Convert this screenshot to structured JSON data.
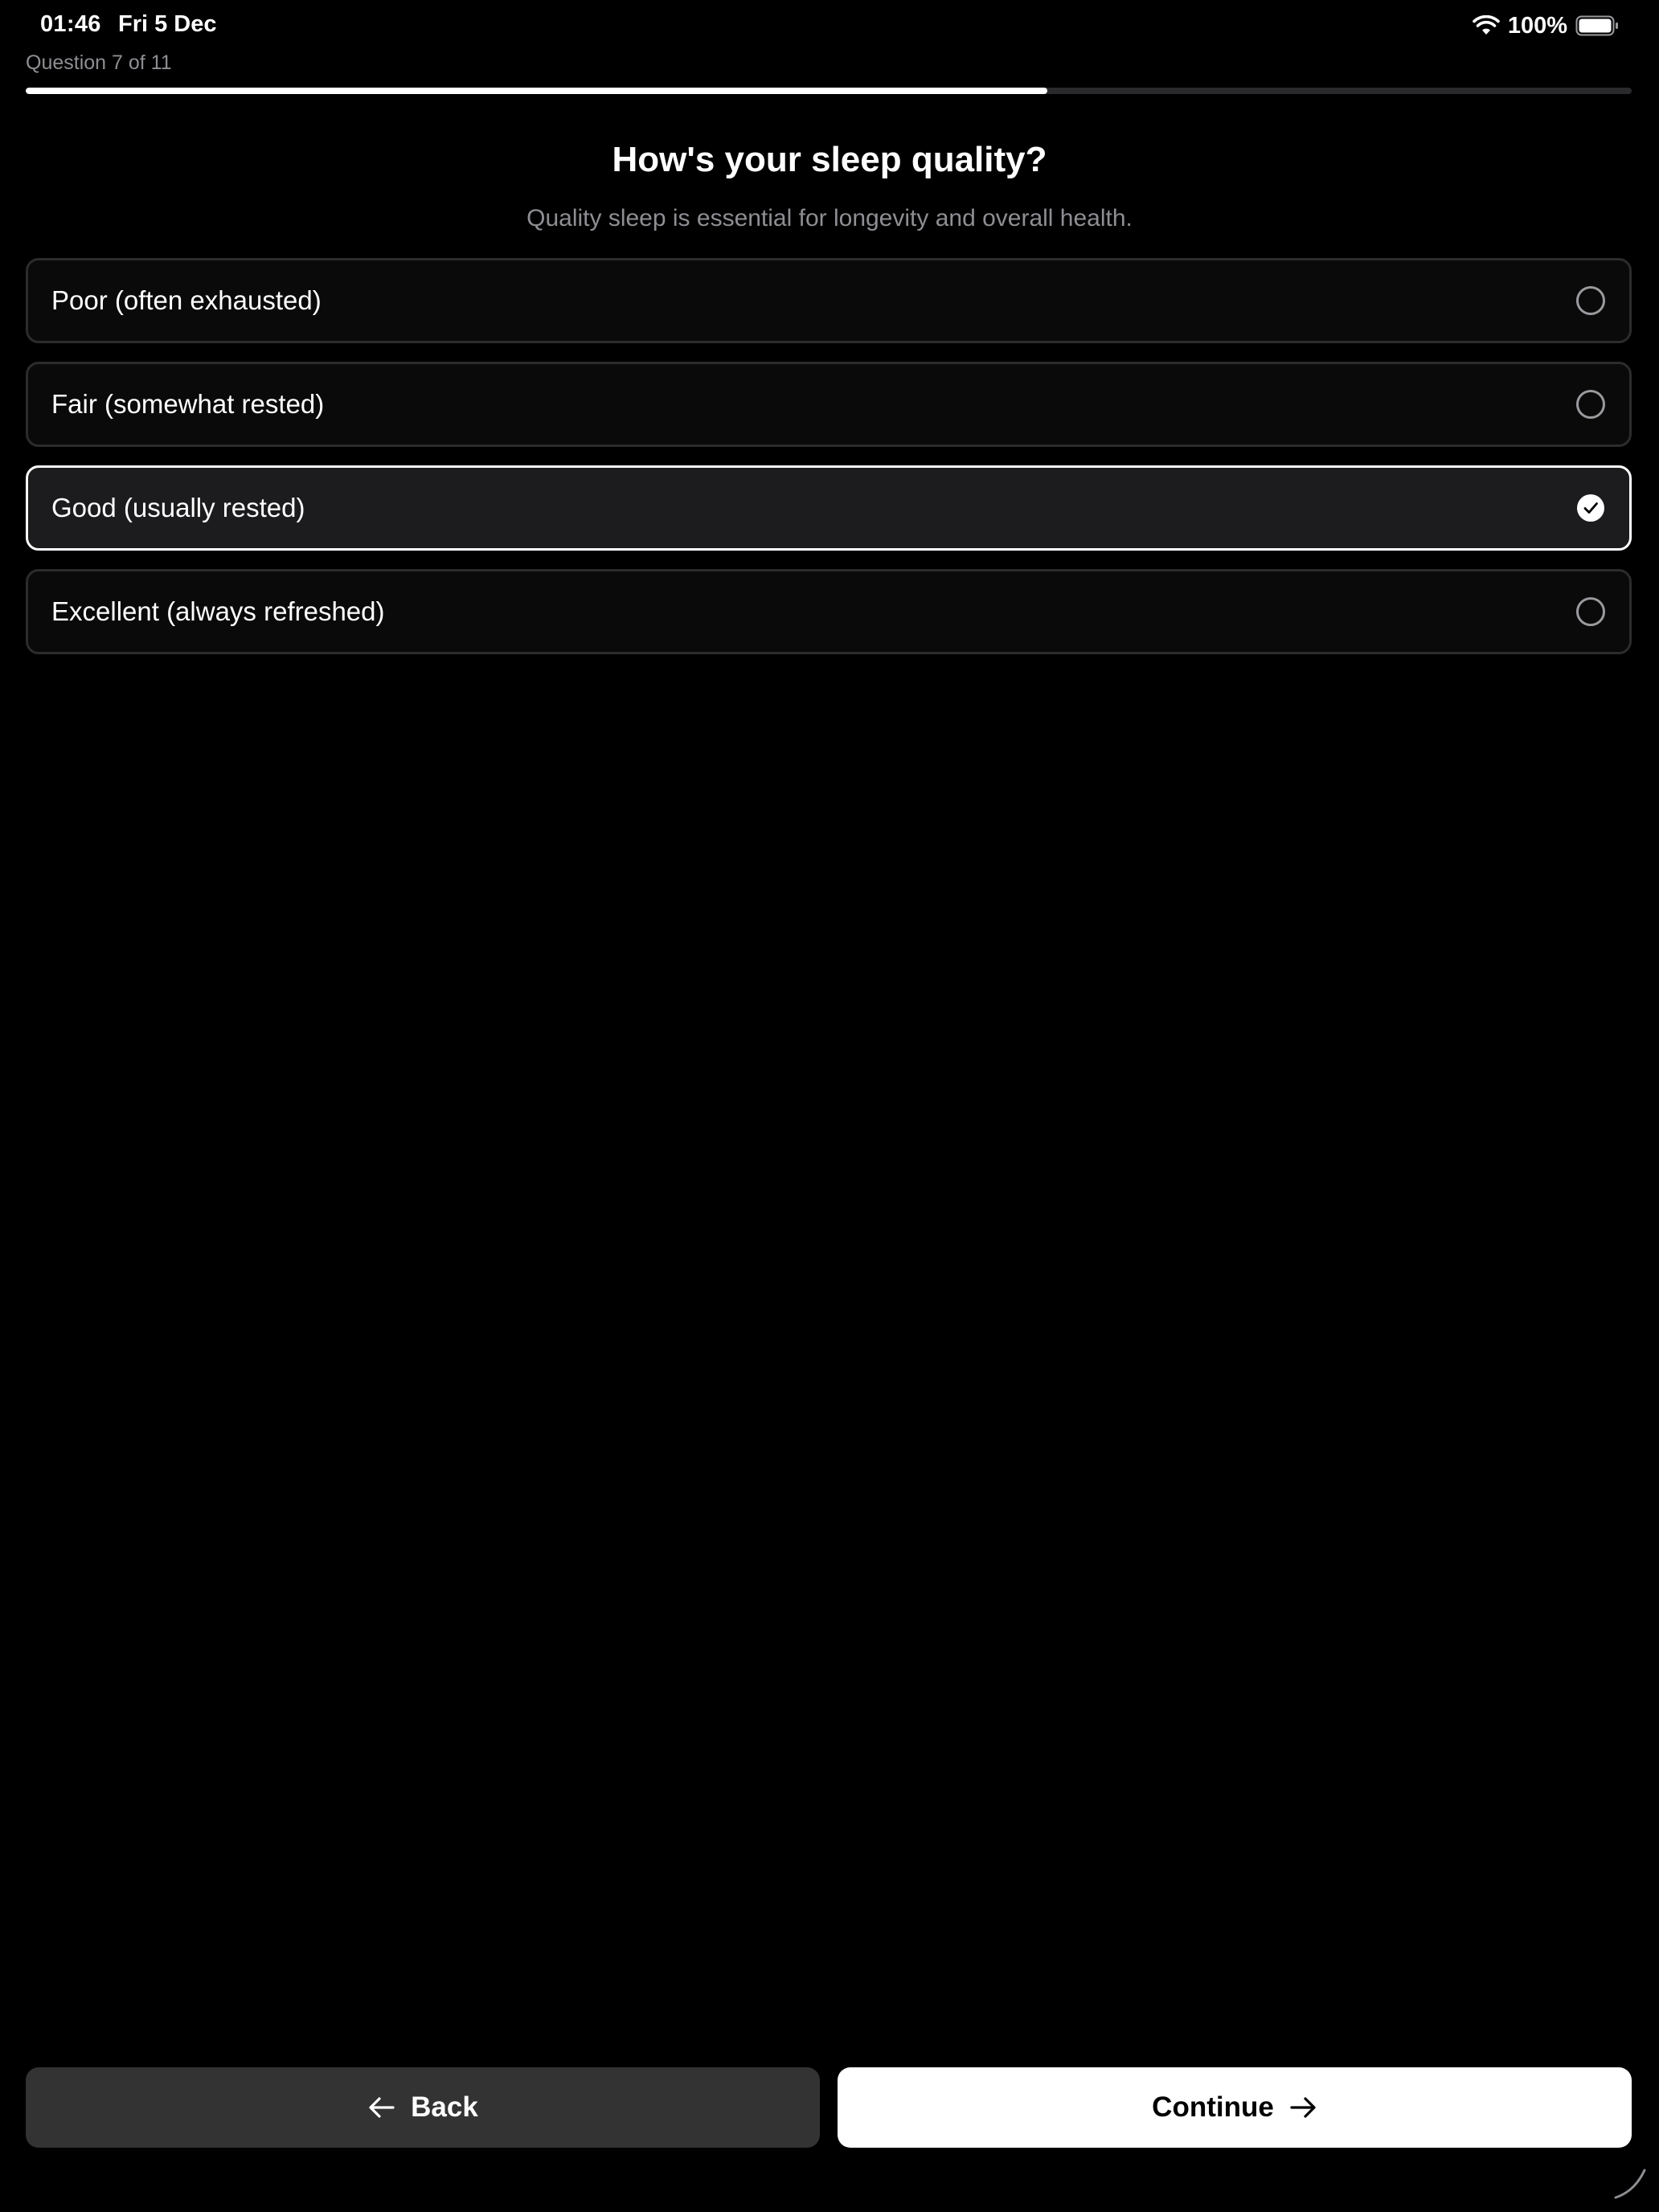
{
  "status_bar": {
    "time": "01:46",
    "date": "Fri 5 Dec",
    "battery": "100%"
  },
  "progress": {
    "counter_text": "Question 7 of 11",
    "fraction": 0.636
  },
  "question": {
    "title": "How's your sleep quality?",
    "subtitle": "Quality sleep is essential for longevity and overall health."
  },
  "options": [
    {
      "label": "Poor (often exhausted)",
      "selected": false
    },
    {
      "label": "Fair (somewhat rested)",
      "selected": false
    },
    {
      "label": "Good (usually rested)",
      "selected": true
    },
    {
      "label": "Excellent (always refreshed)",
      "selected": false
    }
  ],
  "buttons": {
    "back_label": "Back",
    "continue_label": "Continue"
  },
  "colors": {
    "background": "#000000",
    "selected_border": "#ffffff",
    "option_border": "#2c2c2e",
    "muted_text": "#8e8e93"
  }
}
